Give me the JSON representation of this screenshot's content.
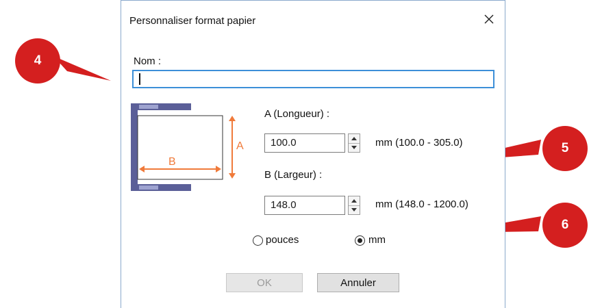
{
  "dialog": {
    "title": "Personnaliser format papier",
    "name_label": "Nom :",
    "name_value": "",
    "length_label": "A (Longueur) :",
    "length_value": "100.0",
    "length_range": "mm (100.0 - 305.0)",
    "width_label": "B (Largeur) :",
    "width_value": "148.0",
    "width_range": "mm (148.0 - 1200.0)",
    "units": [
      {
        "label": "pouces",
        "selected": false
      },
      {
        "label": "mm",
        "selected": true
      }
    ],
    "ok_label": "OK",
    "cancel_label": "Annuler",
    "ok_enabled": false
  },
  "illustration": {
    "dimension_a": "A",
    "dimension_b": "B"
  },
  "callouts": [
    "4",
    "5",
    "6"
  ],
  "colors": {
    "callout": "#d41f1f",
    "dimension": "#f07a3a",
    "tray": "#5b5f98",
    "focus": "#3c8fd8"
  }
}
